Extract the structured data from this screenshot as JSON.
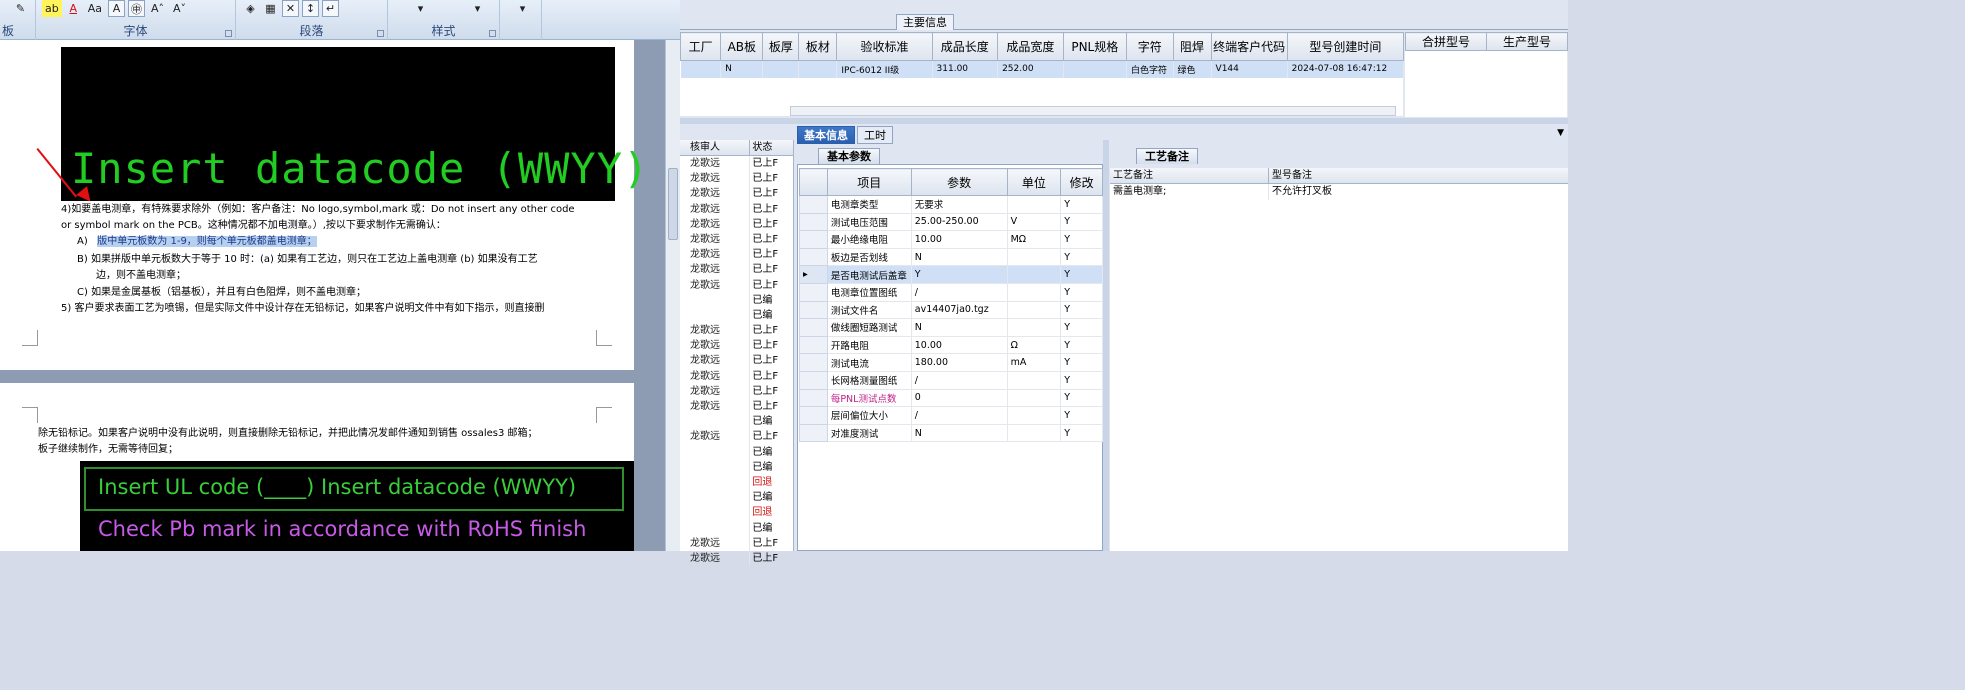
{
  "ribbon": {
    "groups": [
      {
        "label": "板"
      },
      {
        "label": "字体"
      },
      {
        "label": "段落"
      },
      {
        "label": "样式"
      }
    ]
  },
  "word": {
    "page1": {
      "image_text": "Insert datacode (WWYY)",
      "lines": [
        "4)如要盖电测章，有特殊要求除外（例如：客户备注：No logo,symbol,mark 或：Do not insert any other code",
        "or symbol mark on the PCB。这种情况都不加电测章。）,按以下要求制作无需确认：",
        "版中单元板数为 1-9，则每个单元板都盖电测章；",
        "B)  如果拼版中单元板数大于等于 10 时：(a) 如果有工艺边，则只在工艺边上盖电测章 (b) 如果没有工艺",
        "边，则不盖电测章；",
        "C)  如果是金属基板（铝基板），并且有白色阻焊，则不盖电测章；",
        "5) 客户要求表面工艺为喷锡，但是实际文件中设计存在无铅标记，如果客户说明文件中有如下指示，则直接删"
      ],
      "line_a_prefix": "A)"
    },
    "page2": {
      "lines": [
        "除无铅标记。如果客户说明中没有此说明，则直接删除无铅标记，并把此情况发邮件通知到销售 ossales3 邮箱；",
        "板子继续制作，无需等待回复；"
      ],
      "image_line1": "Insert UL code (____)  Insert datacode (WWYY)",
      "image_line2": "Check Pb mark in accordance with RoHS finish"
    }
  },
  "erp": {
    "main_info_tab": "主要信息",
    "top_headers": [
      "工厂",
      "AB板",
      "板厚",
      "板材",
      "验收标准",
      "成品长度",
      "成品宽度",
      "PNL规格",
      "字符",
      "阻焊",
      "终端客户代码",
      "型号创建时间"
    ],
    "top_row": [
      "",
      "N",
      "",
      "",
      "IPC-6012 II级",
      "311.00",
      "252.00",
      "",
      "白色字符",
      "绿色",
      "V144",
      "2024-07-08 16:47:12"
    ],
    "right_headers": [
      "合拼型号",
      "生产型号"
    ],
    "list_headers": [
      "核审人",
      "状态"
    ],
    "list_rows": [
      [
        "龙歌远",
        "已上F"
      ],
      [
        "龙歌远",
        "已上F"
      ],
      [
        "龙歌远",
        "已上F"
      ],
      [
        "龙歌远",
        "已上F"
      ],
      [
        "龙歌远",
        "已上F"
      ],
      [
        "龙歌远",
        "已上F"
      ],
      [
        "龙歌远",
        "已上F"
      ],
      [
        "龙歌远",
        "已上F"
      ],
      [
        "龙歌远",
        "已上F"
      ],
      [
        "",
        "已编"
      ],
      [
        "",
        "已编"
      ],
      [
        "龙歌远",
        "已上F"
      ],
      [
        "龙歌远",
        "已上F"
      ],
      [
        "龙歌远",
        "已上F"
      ],
      [
        "龙歌远",
        "已上F"
      ],
      [
        "龙歌远",
        "已上F"
      ],
      [
        "龙歌远",
        "已上F"
      ],
      [
        "",
        "已编"
      ],
      [
        "龙歌远",
        "已上F"
      ],
      [
        "",
        "已编"
      ],
      [
        "",
        "已编"
      ],
      [
        "",
        "回退"
      ],
      [
        "",
        "已编"
      ],
      [
        "",
        "回退"
      ],
      [
        "",
        "已编"
      ],
      [
        "龙歌远",
        "已上F"
      ],
      [
        "龙歌远",
        "已上F"
      ]
    ],
    "tabs": [
      "基本信息",
      "工时"
    ],
    "param_subtab": "基本参数",
    "remark_subtab": "工艺备注",
    "param_headers": [
      "项目",
      "参数",
      "单位",
      "修改"
    ],
    "params": [
      [
        "电测章类型",
        "无要求",
        "",
        "Y"
      ],
      [
        "测试电压范围",
        "25.00-250.00",
        "V",
        "Y"
      ],
      [
        "最小绝缘电阻",
        "10.00",
        "MΩ",
        "Y"
      ],
      [
        "板边是否划线",
        "N",
        "",
        "Y"
      ],
      [
        "是否电测试后盖章",
        "Y",
        "",
        "Y"
      ],
      [
        "电测章位置图纸",
        "/",
        "",
        "Y"
      ],
      [
        "测试文件名",
        "av14407ja0.tgz",
        "",
        "Y"
      ],
      [
        "做线圈短路测试",
        "N",
        "",
        "Y"
      ],
      [
        "开路电阻",
        "10.00",
        "Ω",
        "Y"
      ],
      [
        "测试电流",
        "180.00",
        "mA",
        "Y"
      ],
      [
        "长网格测量图纸",
        "/",
        "",
        "Y"
      ],
      [
        "每PNL测试点数",
        "0",
        "",
        "Y"
      ],
      [
        "层间偏位大小",
        "/",
        "",
        "Y"
      ],
      [
        "对准度测试",
        "N",
        "",
        "Y"
      ]
    ],
    "remark_headers": [
      "工艺备注",
      "型号备注"
    ],
    "remark_row": [
      "需盖电测章;",
      "不允许打叉板"
    ]
  }
}
